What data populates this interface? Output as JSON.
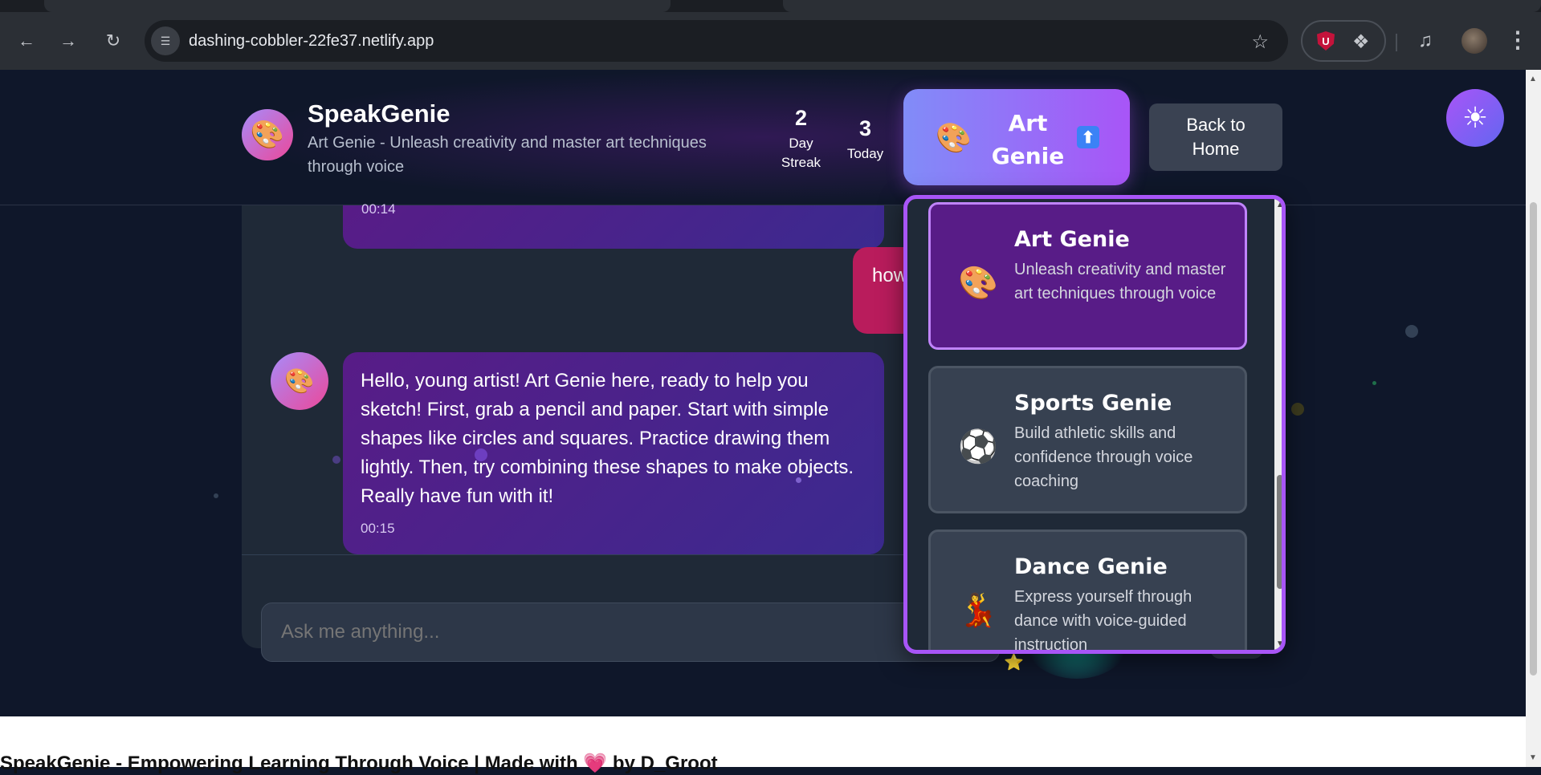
{
  "browser": {
    "url": "dashing-cobbler-22fe37.netlify.app",
    "icons": {
      "back": "arrow-left-icon",
      "forward": "arrow-right-icon",
      "reload": "reload-icon",
      "site_info": "tune-icon",
      "bookmark": "star-outline-icon",
      "extension": "ublock-origin-icon",
      "extensions_menu": "puzzle-icon",
      "media": "media-controls-icon",
      "profile": "avatar",
      "menu": "more-vert-icon"
    },
    "ublock_letter": "U"
  },
  "header": {
    "logo_icon": "🎨",
    "title": "SpeakGenie",
    "subtitle": "Art Genie - Unleash creativity and master art techniques through voice",
    "stats": [
      {
        "value": "2",
        "label": "Day Streak"
      },
      {
        "value": "3",
        "label": "Today"
      }
    ],
    "selector": {
      "icon": "🎨",
      "label": "Art Genie",
      "arrow": "⬆"
    },
    "back_button": "Back to Home",
    "theme_icon": "☀"
  },
  "chat": {
    "prev_time": "00:14",
    "user_message": "how",
    "bot_avatar": "🎨",
    "bot_message": "Hello, young artist! Art Genie here, ready to help you sketch! First, grab a pencil and paper. Start with simple shapes like circles and squares. Practice drawing them lightly. Then, try combining these shapes to make objects. Really have fun with it!",
    "bot_time": "00:15",
    "input_placeholder": "Ask me anything...",
    "star_icon": "⭐"
  },
  "genie_dropdown": {
    "options": [
      {
        "icon": "🎨",
        "title": "Art Genie",
        "description": "Unleash creativity and master art techniques through voice",
        "selected": true
      },
      {
        "icon": "⚽",
        "title": "Sports Genie",
        "description": "Build athletic skills and confidence through voice coaching",
        "selected": false
      },
      {
        "icon": "💃",
        "title": "Dance Genie",
        "description": "Express yourself through dance with voice-guided instruction",
        "selected": false
      }
    ]
  },
  "footer": {
    "text_before": "SpeakGenie - Empowering Learning Through Voice | Made with ",
    "heart": "💗",
    "text_after": " by D_Groot"
  },
  "colors": {
    "page_bg": "#0f172a",
    "accent_purple": "#a855f7",
    "accent_indigo": "#818cf8",
    "bot_bubble": "#581c87",
    "user_bubble": "#b91c5c",
    "panel": "#1f2937"
  }
}
